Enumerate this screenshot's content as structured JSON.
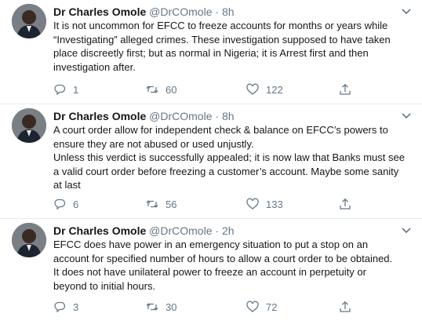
{
  "tweets": [
    {
      "name": "Dr Charles Omole",
      "handle": "@DrCOmole",
      "time": "8h",
      "text": "It is not uncommon for EFCC to freeze accounts for months or years while\n“Investigating” alleged crimes. These investigation supposed to have taken\nplace discreetly first; but as normal in Nigeria; it is Arrest first and then\ninvestigation after.",
      "replies": "1",
      "retweets": "60",
      "likes": "122"
    },
    {
      "name": "Dr Charles Omole",
      "handle": "@DrCOmole",
      "time": "8h",
      "text": "A court order allow for independent check & balance on EFCC’s powers to\nensure they are not abused or used unjustly.\nUnless this verdict is successfully appealed; it is now law that Banks must see\na valid court order before freezing a customer’s account. Maybe some sanity\nat last",
      "replies": "6",
      "retweets": "56",
      "likes": "133"
    },
    {
      "name": "Dr Charles Omole",
      "handle": "@DrCOmole",
      "time": "2h",
      "text": "EFCC does have power in an emergency situation to put a stop on an\naccount for specified number of hours to allow a court order to be obtained.\nIt does not have unilateral power to freeze an account in perpetuity or\nbeyond to initial hours.",
      "replies": "3",
      "retweets": "30",
      "likes": "72"
    }
  ],
  "separator": "·",
  "icons": [
    "chevron-down-icon",
    "reply-icon",
    "retweet-icon",
    "like-icon",
    "share-icon"
  ],
  "colors": {
    "text": "#14171a",
    "secondary": "#657786",
    "divider": "#e6ecf0"
  }
}
